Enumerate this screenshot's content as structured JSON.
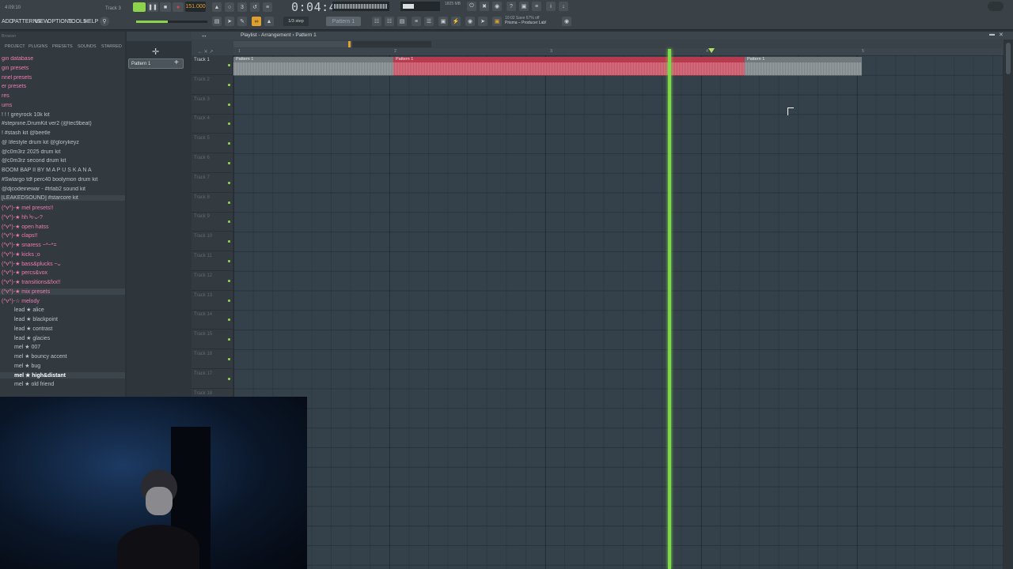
{
  "transport": {
    "song_time": "4:09:10",
    "track_label": "Track 3",
    "tempo": "151.000",
    "time_display": "0:04:41",
    "snap": "1/3 step",
    "pattern": "Pattern 1",
    "news_line1": "10:02  Save 67% off",
    "news_line2": "Prisma – Producer Lab!",
    "cpu": "1825 MB"
  },
  "menu": [
    "ADD",
    "PATTERNS",
    "VIEW",
    "OPTIONS",
    "TOOLS",
    "HELP"
  ],
  "browser": {
    "title": "Browser",
    "tabs": [
      "PROJECT",
      "PLUGINS",
      "PRESETS",
      "SOUNDS",
      "STARRED"
    ],
    "items": [
      {
        "label": "gin database",
        "color": "#f07ab0"
      },
      {
        "label": "gin presets",
        "color": "#f07ab0"
      },
      {
        "label": "nnel presets",
        "color": "#f07ab0"
      },
      {
        "label": "er presets",
        "color": "#f07ab0"
      },
      {
        "label": "res",
        "color": "#f07ab0"
      },
      {
        "label": "ums",
        "color": "#f07ab0"
      },
      {
        "label": "! ! ! greyrock 10k kit",
        "color": "#b8c2c8"
      },
      {
        "label": "#stepnine.DrumKit ver2 (@tec9beat)",
        "color": "#b8c2c8"
      },
      {
        "label": "! #stash kit @beetle",
        "color": "#b8c2c8"
      },
      {
        "label": "@ lifestyle drum kit @glorykeyz",
        "color": "#b8c2c8"
      },
      {
        "label": "@c0m3rz 2025 drum kit",
        "color": "#b8c2c8"
      },
      {
        "label": "@c0m3rz second drum kit",
        "color": "#b8c2c8"
      },
      {
        "label": "BOOM BAP II BY M A P U S K A N A",
        "color": "#b8c2c8"
      },
      {
        "label": "#Swlargo tdf perc40 boolymon drum kit",
        "color": "#b8c2c8"
      },
      {
        "label": "@djcodeinewar - #trlab2 sound kit",
        "color": "#b8c2c8"
      },
      {
        "label": "[LEAKEDSOUND] #starcore kit",
        "color": "#b8c2c8"
      },
      {
        "label": "(^v^)-★ mel presets!!",
        "color": "#f07ab0"
      },
      {
        "label": "(^v^)-★ hh Ϟ-ᴗ-?",
        "color": "#f07ab0"
      },
      {
        "label": "(^v^)-★ open hatss",
        "color": "#f07ab0"
      },
      {
        "label": "(^v^)-★ claps!!",
        "color": "#f07ab0"
      },
      {
        "label": "(^v^)-★ snaress ~*~*=",
        "color": "#f07ab0"
      },
      {
        "label": "(^v^)-★ kicks ;o",
        "color": "#f07ab0"
      },
      {
        "label": "(^v^)-★ bass&plucks ~ᴗ",
        "color": "#f07ab0"
      },
      {
        "label": "(^v^)-★ percs&vox",
        "color": "#f07ab0"
      },
      {
        "label": "(^v^)-★ transitions&fxx!!",
        "color": "#f07ab0"
      },
      {
        "label": "(^v^)-★ mix presets",
        "color": "#f07ab0"
      },
      {
        "label": "(^v^)-☆ melody",
        "color": "#f07ab0"
      },
      {
        "label": "lead ★ alice",
        "color": "#b8c2c8"
      },
      {
        "label": "lead ★ blackpoint",
        "color": "#b8c2c8"
      },
      {
        "label": "lead ★ contrast",
        "color": "#b8c2c8"
      },
      {
        "label": "lead ★ glacies",
        "color": "#b8c2c8"
      },
      {
        "label": "mel ★ 007",
        "color": "#b8c2c8"
      },
      {
        "label": "mel ★ bouncy accent",
        "color": "#b8c2c8"
      },
      {
        "label": "mel ★ bug",
        "color": "#b8c2c8"
      },
      {
        "label": "mel ★ high&distant",
        "color": "#ffffff"
      },
      {
        "label": "mel ★ old friend",
        "color": "#b8c2c8"
      }
    ]
  },
  "channel_rack": {
    "pattern_chip": "Pattern 1"
  },
  "playlist": {
    "title": "Playlist - Arrangement › Pattern 1",
    "bar_numbers": [
      "1",
      "2",
      "3",
      "4",
      "5"
    ],
    "tracks": [
      "Track 1",
      "Track 2",
      "Track 3",
      "Track 4",
      "Track 5",
      "Track 6",
      "Track 7",
      "Track 8",
      "Track 9",
      "Track 10",
      "Track 11",
      "Track 12",
      "Track 13",
      "Track 14",
      "Track 15",
      "Track 16",
      "Track 17",
      "Track 18"
    ],
    "clips": [
      {
        "label": "Pattern 1",
        "color": "#9aa0a4",
        "selected": false
      },
      {
        "label": "Pattern 1",
        "color": "#e07080",
        "selected": true
      },
      {
        "label": "Pattern 1",
        "color": "#9aa0a4",
        "selected": false
      }
    ]
  }
}
